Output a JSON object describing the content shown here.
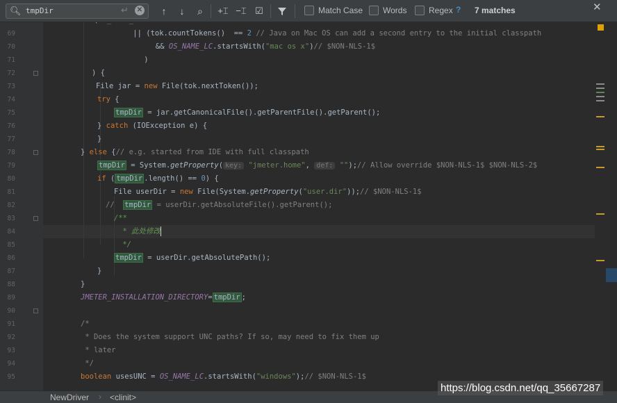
{
  "find": {
    "query": "tmpDir",
    "match_case_label": "Match Case",
    "words_label": "Words",
    "regex_label": "Regex",
    "help_label": "?",
    "result_count": "7 matches"
  },
  "toolbar_icons": [
    "search-icon",
    "enter-icon",
    "clear-icon",
    "previous-occurrence-icon",
    "next-occurrence-icon",
    "find-all-icon",
    "add-occurrence-icon",
    "remove-occurrence-icon",
    "select-all-occurrences-icon",
    "filter-icon",
    "close-icon"
  ],
  "editor": {
    "line_numbers": [
      "69",
      "70",
      "71",
      "72",
      "73",
      "74",
      "75",
      "76",
      "77",
      "78",
      "79",
      "80",
      "81",
      "82",
      "83",
      "84",
      "85",
      "86",
      "87",
      "88",
      "89",
      "90",
      "91",
      "92",
      "93",
      "94",
      "95"
    ],
    "lines": [
      [
        {
          "t": "    ",
          "c": ""
        },
        {
          "t": "|| (tok.countTokens()  == ",
          "c": ""
        },
        {
          "t": "2",
          "c": "num"
        },
        {
          "t": " // Java on Mac OS can add a second entry to the initial classpath",
          "c": "cmt"
        }
      ],
      [
        {
          "t": "      && ",
          "c": ""
        },
        {
          "t": "OS_NAME_LC",
          "c": "fld"
        },
        {
          "t": ".startsWith(",
          "c": ""
        },
        {
          "t": "\"mac os x\"",
          "c": "str"
        },
        {
          "t": ")",
          "c": ""
        },
        {
          "t": "// $NON-NLS-1$",
          "c": "cmt"
        }
      ],
      [
        {
          "t": "    )",
          "c": ""
        }
      ],
      [
        {
          "t": ") {",
          "c": ""
        }
      ],
      [
        {
          "t": "File jar = ",
          "c": ""
        },
        {
          "t": "new",
          "c": "kw"
        },
        {
          "t": " File(tok.nextToken());",
          "c": ""
        }
      ],
      [
        {
          "t": "try",
          "c": "kw"
        },
        {
          "t": " {",
          "c": ""
        }
      ],
      [
        {
          "t": "tmpDir",
          "c": "hl"
        },
        {
          "t": " = jar.getCanonicalFile().getParentFile().getParent();",
          "c": ""
        }
      ],
      [
        {
          "t": "} ",
          "c": ""
        },
        {
          "t": "catch",
          "c": "kw"
        },
        {
          "t": " (IOException e) {",
          "c": ""
        }
      ],
      [
        {
          "t": "}",
          "c": ""
        }
      ],
      [
        {
          "t": "} ",
          "c": ""
        },
        {
          "t": "else",
          "c": "kw"
        },
        {
          "t": " {",
          "c": ""
        },
        {
          "t": "// e.g. started from IDE with full classpath",
          "c": "cmt"
        }
      ],
      [
        {
          "t": "tmpDir",
          "c": "hl"
        },
        {
          "t": " = System.",
          "c": ""
        },
        {
          "t": "getProperty",
          "c": "st"
        },
        {
          "t": "(",
          "c": ""
        },
        {
          "t": "key:",
          "c": "hint"
        },
        {
          "t": " ",
          "c": ""
        },
        {
          "t": "\"jmeter.home\"",
          "c": "str"
        },
        {
          "t": ", ",
          "c": ""
        },
        {
          "t": "def:",
          "c": "hint"
        },
        {
          "t": " ",
          "c": ""
        },
        {
          "t": "\"\"",
          "c": "str"
        },
        {
          "t": ");",
          "c": ""
        },
        {
          "t": "// Allow override $NON-NLS-1$ $NON-NLS-2$",
          "c": "cmt"
        }
      ],
      [
        {
          "t": "if",
          "c": "kw"
        },
        {
          "t": " (",
          "c": ""
        },
        {
          "t": "tmpDir",
          "c": "hl"
        },
        {
          "t": ".length() == ",
          "c": ""
        },
        {
          "t": "0",
          "c": "num"
        },
        {
          "t": ") {",
          "c": ""
        }
      ],
      [
        {
          "t": "File userDir = ",
          "c": ""
        },
        {
          "t": "new",
          "c": "kw"
        },
        {
          "t": " File(System.",
          "c": ""
        },
        {
          "t": "getProperty",
          "c": "st"
        },
        {
          "t": "(",
          "c": ""
        },
        {
          "t": "\"user.dir\"",
          "c": "str"
        },
        {
          "t": "));",
          "c": ""
        },
        {
          "t": "// $NON-NLS-1$",
          "c": "cmt"
        }
      ],
      [
        {
          "t": "//  ",
          "c": "cmt"
        },
        {
          "t": "tmpDir",
          "c": "hl"
        },
        {
          "t": " = userDir.getAbsoluteFile().getParent();",
          "c": "cmt"
        }
      ],
      [
        {
          "t": "/**",
          "c": "doc"
        }
      ],
      [
        {
          "t": " * ",
          "c": "doc"
        },
        {
          "t": "此处修改",
          "c": "doc"
        }
      ],
      [
        {
          "t": " */",
          "c": "doc"
        }
      ],
      [
        {
          "t": "tmpDir",
          "c": "hl"
        },
        {
          "t": " = userDir.getAbsolutePath();",
          "c": ""
        }
      ],
      [
        {
          "t": "}",
          "c": ""
        }
      ],
      [
        {
          "t": "}",
          "c": ""
        }
      ],
      [
        {
          "t": "JMETER_INSTALLATION_DIRECTORY",
          "c": "fld"
        },
        {
          "t": "=",
          "c": ""
        },
        {
          "t": "tmpDir",
          "c": "hl"
        },
        {
          "t": ";",
          "c": ""
        }
      ],
      [],
      [
        {
          "t": "/*",
          "c": "cmt"
        }
      ],
      [
        {
          "t": " * Does the system support UNC paths? If so, may need to fix them up",
          "c": "cmt"
        }
      ],
      [
        {
          "t": " * later",
          "c": "cmt"
        }
      ],
      [
        {
          "t": " */",
          "c": "cmt"
        }
      ],
      [
        {
          "t": "boolean",
          "c": "kw"
        },
        {
          "t": " usesUNC = ",
          "c": ""
        },
        {
          "t": "OS_NAME_LC",
          "c": "fld"
        },
        {
          "t": ".startsWith(",
          "c": ""
        },
        {
          "t": "\"windows\"",
          "c": "str"
        },
        {
          "t": ");",
          "c": ""
        },
        {
          "t": "// $NON-NLS-1$",
          "c": "cmt"
        }
      ]
    ],
    "partial_top_line": [
      {
        "t": "if (OS_NAME_LC ...",
        "c": "kw"
      }
    ]
  },
  "breadcrumb": {
    "items": [
      "NewDriver",
      "<clinit>"
    ]
  },
  "watermark": "https://blog.csdn.net/qq_35667287",
  "colors": {
    "background": "#2b2b2b",
    "keyword": "#cc7832",
    "string": "#6a8759",
    "comment": "#808080",
    "doc_comment": "#629755",
    "number": "#6897bb",
    "static_field": "#9876aa",
    "match_highlight": "#32593d",
    "stripe_marker": "#c69a2c"
  }
}
